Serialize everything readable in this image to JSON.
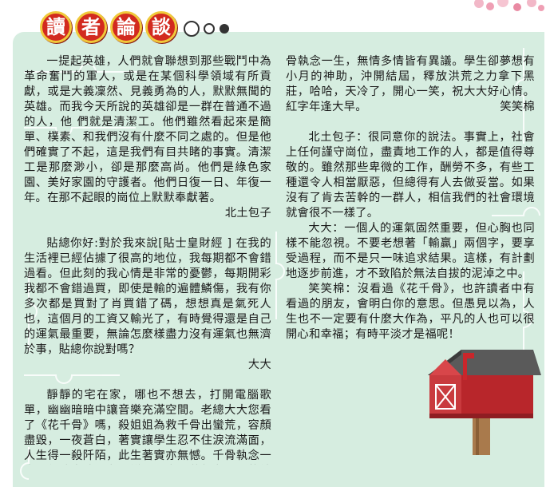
{
  "header": {
    "title_chars": [
      "讀",
      "者",
      "論",
      "談"
    ]
  },
  "articles": [
    {
      "paragraphs": [
        "一提起英雄，人們就會聯想到那些戰鬥中為革命奮鬥的軍人，或是在某個科學領域有所貢獻，或是大義凜然、見義勇為的人，默默無聞的英雄。而我今天所說的英雄卻是一群在普通不過的人，他 們就是清潔工。他們雖然看起來是簡單、樸素、和我們沒有什麼不同之處的。但是他們確實了不起，這是我們有目共睹的事實。清潔工是那麼渺小，卻是那麼高尚。他們是綠色家園、美好家園的守護者。他們日復一日、年復一年。在那不起眼的崗位上默默奉獻著。"
      ],
      "signature": "北土包子"
    },
    {
      "paragraphs": [
        "貼總你好:對於我來說[貼士皇財經 ] 在我的生活裡已經佔據了很高的地位，我每期都不會錯過看。但此刻的我心情是非常的憂鬱，每期開彩我都不會錯過買，即使是輸的遍體鱗傷，我有你多次都是買對了肖買錯了碼，想想真是氣死人也，這個月的工資又輸光了，有時覺得還是自己的運氣最重要，無論怎麼樣盡力沒有運氣也無濟於事，貼總你說對嗎？"
      ],
      "signature": "大大"
    },
    {
      "paragraphs": [
        "靜靜的宅在家，哪也不想去，打開電腦歌單，幽幽暗暗中讓音樂充滿空間。老總大大您看了《花千骨》嗎，殺姐姐為救千骨出蠻荒，容顏盡毀，一夜蒼白，著實讓學生忍不住淚流滿面，人生得一殺阡陌，此生著實亦無憾。千骨執念一生，無情多情皆有異議。學生卻夢想有小月的神助，沖開結屆，釋放洪荒之力拿下黑莊，哈哈，天冷了，開心一笑，祝大大好心情。紅字年逢大早。"
      ],
      "signature": "笑笑棉"
    },
    {
      "paragraphs": [
        "北土包子：很同意你的說法。事實上，社會上任何謹守崗位，盡責地工作的人，都是值得尊敬的。雖然那些卑微的工作，酬勞不多，有些工種還令人相當厭惡，但總得有人去做妥當。如果沒有了肯去苦幹的一群人，相信我們的社會環境就會很不一樣了。",
        "大大：一個人的運氣固然重要，但心胸也同樣不能忽視。不要老想著「輸贏」兩個字，要享受過程，而不是只一味追求結果。這樣，有計劃地逐步前進，才不致陷於無法自拔的泥淖之中。",
        "笑笑棉：沒看過《花千骨》，也許讀者中有看過的朋友，會明白你的意思。但愚見以為，人生也不一定要有什麼大作為，平凡的人也可以很開心和幸福；有時平淡才是福呢！"
      ],
      "signature": ""
    }
  ],
  "colors": {
    "panel": "#d6ede0",
    "title_bubble": "#d22a1f",
    "title_border": "#f0c93a",
    "text": "#1a1a1a",
    "mailbox_red": "#b8262b"
  },
  "icons": [
    "mailbox-icon",
    "flower-decoration-icon"
  ]
}
